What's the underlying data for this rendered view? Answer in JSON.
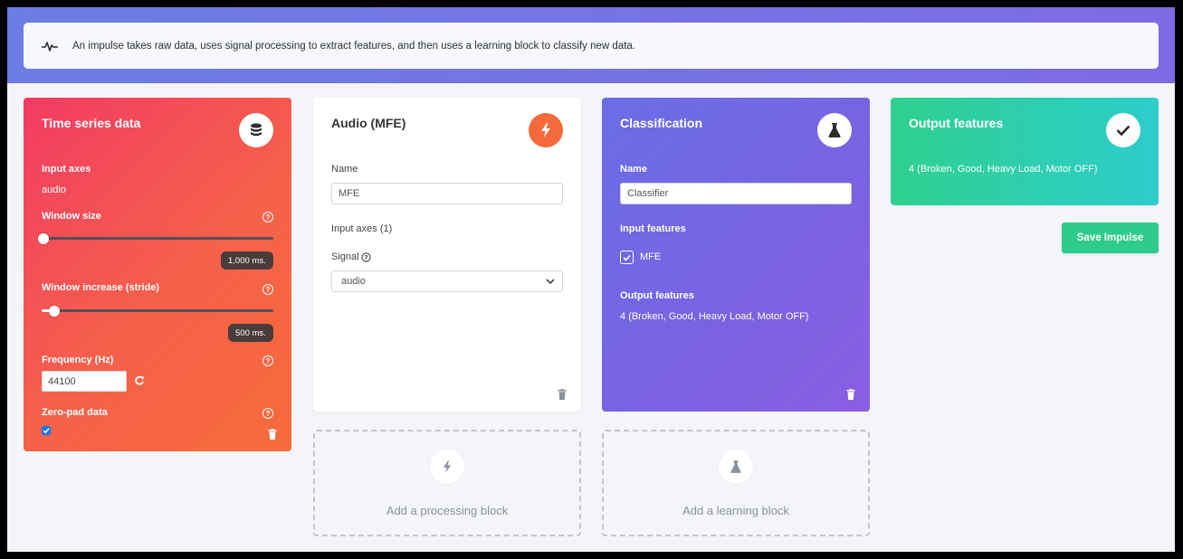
{
  "banner": {
    "text": "An impulse takes raw data, uses signal processing to extract features, and then uses a learning block to classify new data."
  },
  "time_series": {
    "title": "Time series data",
    "input_axes_label": "Input axes",
    "input_axes_value": "audio",
    "window_size_label": "Window size",
    "window_size_value": "1,000 ms.",
    "window_size_fraction": 0.0,
    "window_increase_label": "Window increase (stride)",
    "window_increase_value": "500 ms.",
    "window_increase_fraction": 0.05,
    "frequency_label": "Frequency (Hz)",
    "frequency_value": "44100",
    "zero_pad_label": "Zero-pad data",
    "zero_pad_checked": true
  },
  "processing": {
    "title": "Audio (MFE)",
    "name_label": "Name",
    "name_value": "MFE",
    "input_axes_label": "Input axes (1)",
    "signal_label": "Signal",
    "signal_value": "audio"
  },
  "learning": {
    "title": "Classification",
    "name_label": "Name",
    "name_value": "Classifier",
    "input_features_label": "Input features",
    "input_feature_mfe": "MFE",
    "output_features_label": "Output features",
    "output_features_value": "4 (Broken, Good, Heavy Load, Motor OFF)"
  },
  "output": {
    "title": "Output features",
    "value": "4 (Broken, Good, Heavy Load, Motor OFF)"
  },
  "actions": {
    "save_impulse": "Save Impulse",
    "add_processing": "Add a processing block",
    "add_learning": "Add a learning block"
  },
  "colors": {
    "time_series_gradient": [
      "#f23b63",
      "#f66b3b"
    ],
    "classification_gradient": [
      "#6a6de6",
      "#8a5ee3"
    ],
    "output_gradient": [
      "#2ed08f",
      "#2dcdcc"
    ],
    "save_button": "#2ecc8b",
    "processing_badge": "#f46a3a"
  },
  "icons": {
    "banner": "pulse-icon",
    "time_series": "database-icon",
    "processing": "bolt-icon",
    "learning": "flask-icon",
    "output": "check-icon",
    "delete": "trash-icon",
    "help": "question-circle-icon",
    "reset": "refresh-icon"
  }
}
